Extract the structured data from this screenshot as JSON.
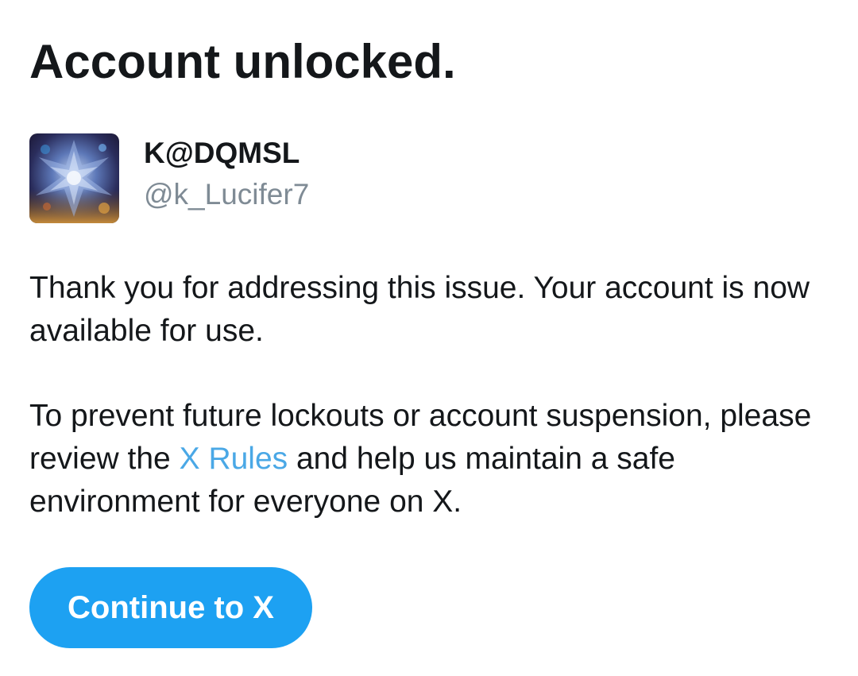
{
  "header": {
    "title": "Account unlocked."
  },
  "profile": {
    "display_name": "K@DQMSL",
    "handle": "@k_Lucifer7",
    "avatar_icon": "profile-avatar-image"
  },
  "message": {
    "paragraph1": "Thank you for addressing this issue. Your account is now available for use.",
    "paragraph2_before": "To prevent future lockouts or account suspension, please review the ",
    "paragraph2_link": "X Rules",
    "paragraph2_after": " and help us maintain a safe environment for everyone on X."
  },
  "actions": {
    "continue_label": "Continue to X"
  },
  "colors": {
    "accent": "#1da1f2",
    "link": "#4aa8e6",
    "text": "#14171a",
    "secondary_text": "#7f8b95"
  }
}
